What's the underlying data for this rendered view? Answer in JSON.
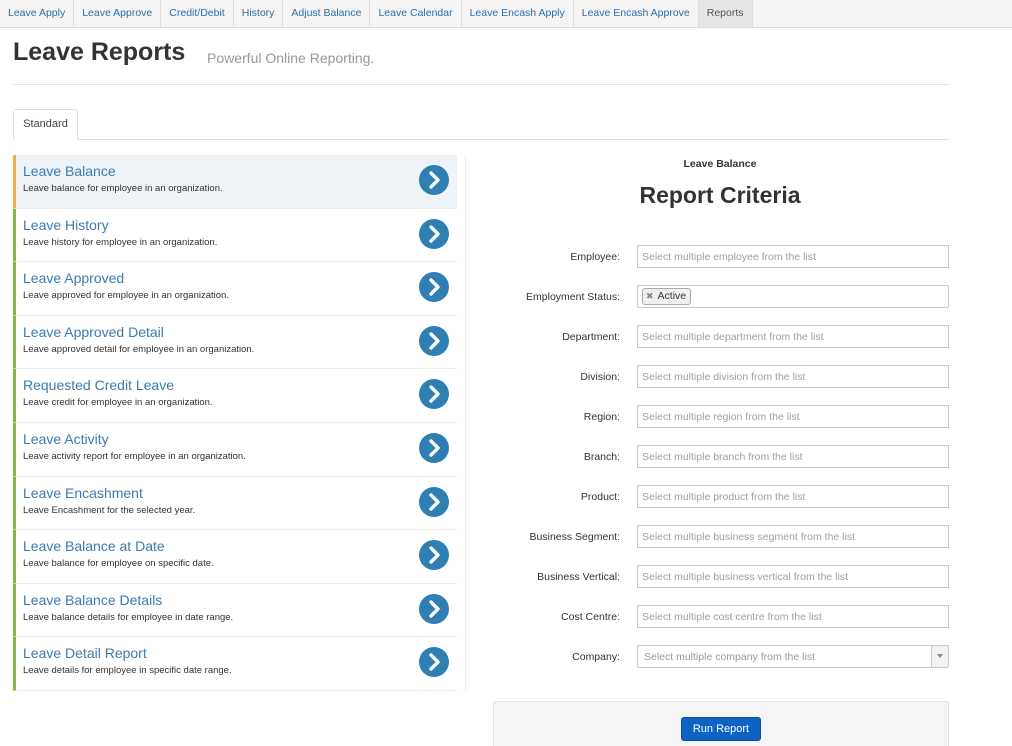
{
  "nav": {
    "items": [
      {
        "label": "Leave Apply",
        "active": false
      },
      {
        "label": "Leave Approve",
        "active": false
      },
      {
        "label": "Credit/Debit",
        "active": false
      },
      {
        "label": "History",
        "active": false
      },
      {
        "label": "Adjust Balance",
        "active": false
      },
      {
        "label": "Leave Calendar",
        "active": false
      },
      {
        "label": "Leave Encash Apply",
        "active": false
      },
      {
        "label": "Leave Encash Approve",
        "active": false
      },
      {
        "label": "Reports",
        "active": true
      }
    ]
  },
  "header": {
    "title": "Leave Reports",
    "subtitle": "Powerful Online Reporting."
  },
  "tabs": {
    "standard": "Standard"
  },
  "reports": [
    {
      "title": "Leave Balance",
      "desc": "Leave balance for employee in an organization.",
      "selected": true
    },
    {
      "title": "Leave History",
      "desc": "Leave history for employee in an organization.",
      "selected": false
    },
    {
      "title": "Leave Approved",
      "desc": "Leave approved for employee in an organization.",
      "selected": false
    },
    {
      "title": "Leave Approved Detail",
      "desc": "Leave approved detail for employee in an organization.",
      "selected": false
    },
    {
      "title": "Requested Credit Leave",
      "desc": "Leave credit for employee in an organization.",
      "selected": false
    },
    {
      "title": "Leave Activity",
      "desc": "Leave activity report for employee in an organization.",
      "selected": false
    },
    {
      "title": "Leave Encashment",
      "desc": "Leave Encashment for the selected year.",
      "selected": false
    },
    {
      "title": "Leave Balance at Date",
      "desc": "Leave balance for employee on specific date.",
      "selected": false
    },
    {
      "title": "Leave Balance Details",
      "desc": "Leave balance details for employee in date range.",
      "selected": false
    },
    {
      "title": "Leave Detail Report",
      "desc": "Leave details for employee in specific date range.",
      "selected": false
    }
  ],
  "criteria": {
    "report_name": "Leave Balance",
    "title": "Report Criteria",
    "fields": {
      "employee": {
        "label": "Employee:",
        "placeholder": "Select multiple employee from the list"
      },
      "employment_status": {
        "label": "Employment Status:",
        "tag": "Active"
      },
      "department": {
        "label": "Department:",
        "placeholder": "Select multiple department from the list"
      },
      "division": {
        "label": "Division:",
        "placeholder": "Select multiple division from the list"
      },
      "region": {
        "label": "Region:",
        "placeholder": "Select multiple region from the list"
      },
      "branch": {
        "label": "Branch:",
        "placeholder": "Select multiple branch from the list"
      },
      "product": {
        "label": "Product:",
        "placeholder": "Select multiple product from the list"
      },
      "business_segment": {
        "label": "Business Segment:",
        "placeholder": "Select multiple business segment from the list"
      },
      "business_vertical": {
        "label": "Business Vertical:",
        "placeholder": "Select multiple business vertical from the list"
      },
      "cost_centre": {
        "label": "Cost Centre:",
        "placeholder": "Select multiple cost centre from the list"
      },
      "company": {
        "label": "Company:",
        "placeholder": "Select multiple company from the list"
      }
    },
    "run_label": "Run Report"
  },
  "colors": {
    "link_blue": "#3b7bb0",
    "arrow_blue": "#2f7fb4",
    "accent_green": "#7dbb42",
    "selected_orange": "#f0ad4e",
    "button_blue": "#0d63c4"
  }
}
